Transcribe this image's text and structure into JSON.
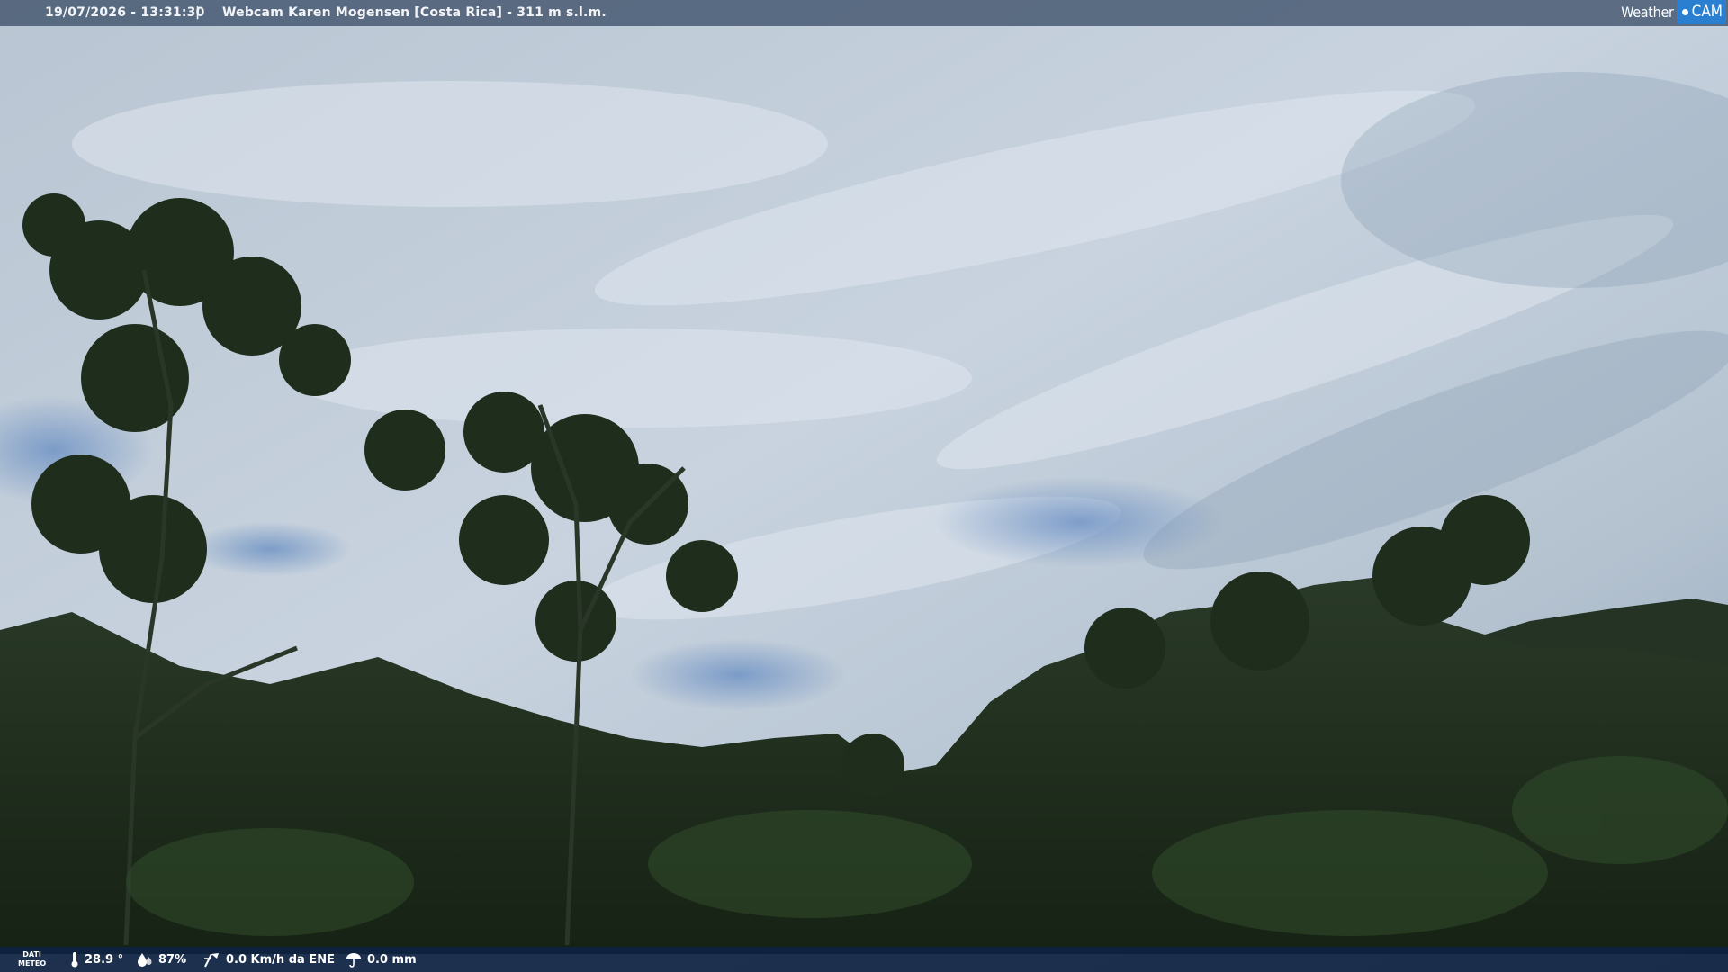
{
  "header": {
    "timestamp": "19/07/2026 - 13:31:30",
    "separator": "|",
    "title": "Webcam Karen Mogensen [Costa Rica] - 311 m s.l.m."
  },
  "logo": {
    "left_text": "Weather",
    "right_text": "CAM"
  },
  "weather": {
    "label_line1": "DATI",
    "label_line2": "METEO",
    "temperature": "28.9 °",
    "humidity": "87%",
    "wind": "0.0 Km/h da ENE",
    "rain": "0.0 mm"
  },
  "icons": [
    "thermometer-icon",
    "humidity-icon",
    "wind-icon",
    "rain-icon"
  ],
  "colors": {
    "sky": "#c4d0dc",
    "forest": "#1f2e1e",
    "bar_bottom": "#0f2341",
    "logo_blue": "#2a7fd0"
  }
}
